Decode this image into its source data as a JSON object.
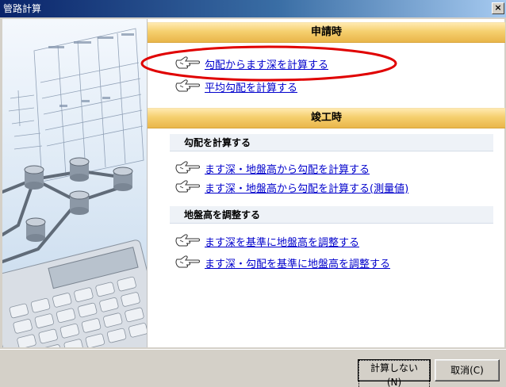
{
  "window": {
    "title": "管路計算",
    "close_label": "×"
  },
  "application_sections": {
    "header": "申請時",
    "links": [
      {
        "label": "勾配からます深を計算する"
      },
      {
        "label": "平均勾配を計算する"
      }
    ]
  },
  "completion_sections": {
    "header": "竣工時",
    "groups": [
      {
        "subheader": "勾配を計算する",
        "links": [
          {
            "label": "ます深・地盤高から勾配を計算する"
          },
          {
            "label": "ます深・地盤高から勾配を計算する(測量値)"
          }
        ]
      },
      {
        "subheader": "地盤高を調整する",
        "links": [
          {
            "label": "ます深を基準に地盤高を調整する"
          },
          {
            "label": "ます深・勾配を基準に地盤高を調整する"
          }
        ]
      }
    ]
  },
  "buttons": {
    "no_compute": "計算しない(N)",
    "cancel": "取消(C)"
  },
  "colors": {
    "title_bar": "#0a246a",
    "section_header": "#f5cf6e",
    "link": "#0000cc",
    "highlight": "#e00000"
  },
  "icons": {
    "link_icon": "pointing-hand-icon",
    "close_icon": "close-icon"
  }
}
